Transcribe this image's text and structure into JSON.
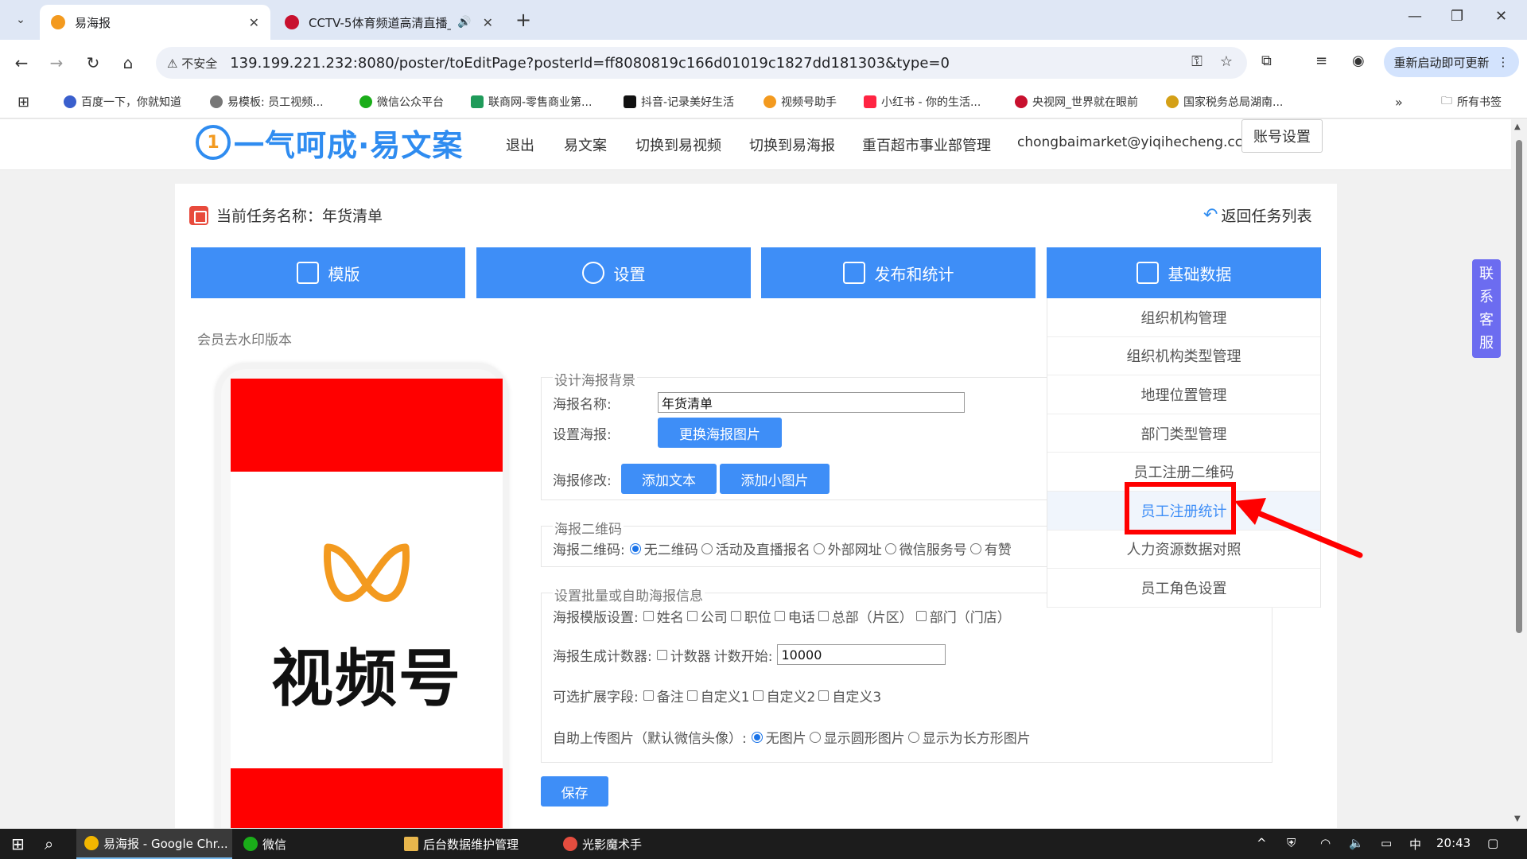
{
  "browser": {
    "tabs": [
      {
        "title": "易海报",
        "active": true
      },
      {
        "title": "CCTV-5体育频道高清直播_",
        "active": false
      }
    ],
    "address": {
      "security_label": "⚠ 不安全",
      "url": "139.199.221.232:8080/poster/toEditPage?posterId=ff8080819c166d01019c1827dd181303&type=0"
    },
    "update_button": "重新启动即可更新",
    "bookmarks": [
      "百度一下，你就知道",
      "易模板: 员工视频...",
      "微信公众平台",
      "联商网-零售商业第...",
      "抖音-记录美好生活",
      "视频号助手",
      "小红书 - 你的生活...",
      "央视网_世界就在眼前",
      "国家税务总局湖南..."
    ],
    "all_bookmarks": "所有书签"
  },
  "site": {
    "logo_text": "一气呵成·易文案",
    "nav": [
      "退出",
      "易文案",
      "切换到易视频",
      "切换到易海报",
      "重百超市事业部管理",
      "chongbaimarket@yiqihecheng.cc"
    ],
    "account_button": "账号设置"
  },
  "task": {
    "title": "当前任务名称：年货清单",
    "back_link": "返回任务列表"
  },
  "main_buttons": [
    "模版",
    "设置",
    "发布和统计",
    "基础数据"
  ],
  "dropdown": {
    "items": [
      "组织机构管理",
      "组织机构类型管理",
      "地理位置管理",
      "部门类型管理",
      "员工注册二维码",
      "员工注册统计",
      "人力资源数据对照",
      "员工角色设置"
    ],
    "highlighted_index": 5
  },
  "member_note": "会员去水印版本",
  "preview": {
    "logo_text": "视频号"
  },
  "form": {
    "background": {
      "legend": "设计海报背景",
      "name_label": "海报名称:",
      "name_value": "年货清单",
      "set_label": "设置海报:",
      "change_image_button": "更换海报图片",
      "modify_label": "海报修改:",
      "add_text_button": "添加文本",
      "add_image_button": "添加小图片"
    },
    "qrcode": {
      "legend": "海报二维码",
      "label": "海报二维码:",
      "options": [
        "无二维码",
        "活动及直播报名",
        "外部网址",
        "微信服务号",
        "有赞"
      ],
      "selected_index": 0
    },
    "batch": {
      "legend": "设置批量或自助海报信息",
      "template_label": "海报模版设置:",
      "template_options": [
        "姓名",
        "公司",
        "职位",
        "电话",
        "总部（片区）",
        "部门（门店）"
      ],
      "counter_label": "海报生成计数器:",
      "counter_checkbox": "计数器",
      "counter_start_label": "计数开始:",
      "counter_start_value": "10000",
      "ext_label": "可选扩展字段:",
      "ext_options": [
        "备注",
        "自定义1",
        "自定义2",
        "自定义3"
      ],
      "upload_label": "自助上传图片（默认微信头像）:",
      "upload_options": [
        "无图片",
        "显示圆形图片",
        "显示为长方形图片"
      ],
      "upload_selected_index": 0
    },
    "save_button": "保存"
  },
  "service_tab": [
    "联",
    "系",
    "客",
    "服"
  ],
  "taskbar": {
    "items": [
      "易海报 - Google Chr...",
      "微信",
      "后台数据维护管理",
      "光影魔术手"
    ],
    "ime": "中",
    "clock": "20:43"
  },
  "colors": {
    "accent": "#3e8ef7",
    "highlight_red": "#ff0000",
    "service_purple": "#6c6cf0"
  }
}
